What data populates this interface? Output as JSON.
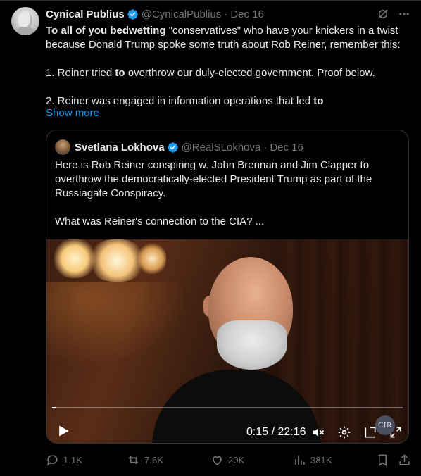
{
  "tweet": {
    "author_name": "Cynical Publius",
    "author_handle": "@CynicalPublius",
    "date": "Dec 16",
    "text_line1_bold": "To all of you bedwetting",
    "text_line1_rest": " \"conservatives\" who have your knickers in a twist because Donald Trump spoke some truth about Rob Reiner, remember this:",
    "point1_pre": "1. Reiner tried ",
    "point1_bold": "to",
    "point1_post": " overthrow our duly-elected government.  Proof below.",
    "point2_pre": "2. Reiner was engaged in information operations that led ",
    "point2_bold": "to",
    "show_more": "Show more"
  },
  "quote": {
    "author_name": "Svetlana Lokhova",
    "author_handle": "@RealSLokhova",
    "date": "Dec 16",
    "text": "Here is Rob Reiner conspiring w. John Brennan and Jim Clapper to overthrow the democratically-elected President Trump as part of the Russiagate Conspiracy.",
    "text2": "What was Reiner's connection to the CIA? ..."
  },
  "video": {
    "time": "0:15 / 22:16",
    "progress": 0.011,
    "watermark": "CIR"
  },
  "actions": {
    "replies": "1.1K",
    "reposts": "7.6K",
    "likes": "20K",
    "views": "381K"
  },
  "colors": {
    "accent": "#1d9bf0",
    "muted": "#71767b",
    "text": "#e7e9ea",
    "border": "#2f3336"
  },
  "icons": [
    "verified-icon",
    "grok-icon",
    "more-icon",
    "play-icon",
    "mute-icon",
    "settings-icon",
    "pip-icon",
    "fullscreen-icon",
    "reply-icon",
    "repost-icon",
    "like-icon",
    "views-icon",
    "bookmark-icon",
    "share-icon"
  ]
}
